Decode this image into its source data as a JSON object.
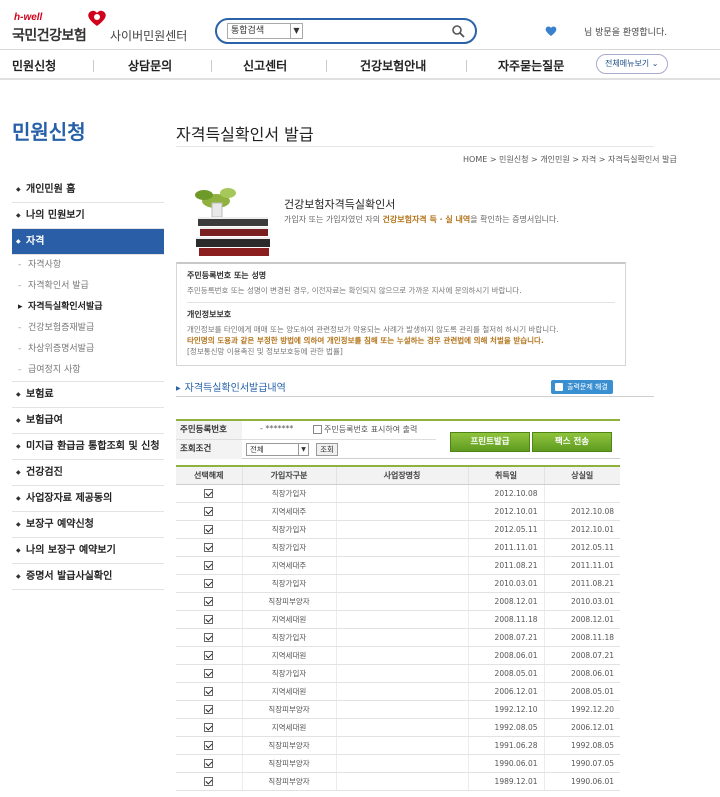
{
  "brand": {
    "sub": "h-well",
    "name": "국민건강보험",
    "center": "사이버민원센터"
  },
  "search": {
    "select_value": "통합검색",
    "query": ""
  },
  "welcome": "님 방문을 환영합니다.",
  "gnb": {
    "items": [
      "민원신청",
      "상담문의",
      "신고센터",
      "건강보험안내",
      "자주묻는질문"
    ],
    "all_menu": "전체메뉴보기"
  },
  "sidebar": {
    "title": "민원신청",
    "items": [
      {
        "label": "개인민원 홈"
      },
      {
        "label": "나의 민원보기"
      },
      {
        "label": "자격"
      },
      {
        "label": "보험료"
      },
      {
        "label": "보험급여"
      },
      {
        "label": "미지급 환급금 통합조회 및 신청"
      },
      {
        "label": "건강검진"
      },
      {
        "label": "사업장자료 제공동의"
      },
      {
        "label": "보장구 예약신청"
      },
      {
        "label": "나의 보장구 예약보기"
      },
      {
        "label": "증명서 발급사실확인"
      }
    ],
    "sub_items": [
      "자격사항",
      "자격확인서 발급",
      "자격득실확인서발급",
      "건강보험증재발급",
      "차상위증명서발급",
      "급여정지 사항"
    ]
  },
  "page": {
    "title": "자격득실확인서 발급",
    "breadcrumb": "HOME > 민원신청 > 개인민원 > 자격 > 자격득실확인서 발급"
  },
  "intro": {
    "title": "건강보험자격득실확인서",
    "desc_prefix": "가입자 또는 가입자였던 자의 ",
    "desc_highlight": "건강보험자격 득 · 실 내역",
    "desc_suffix": "을 확인하는 증명서입니다."
  },
  "notice": {
    "h1": "주민등록번호 또는 성명",
    "p1": "주민등록번호 또는 성명이 변경된 경우, 이전자료는 확인되지 않으므로 가까운 지사에 문의하시기 바랍니다.",
    "h2": "개인정보보호",
    "p2": "개인정보를 타인에게 매매 또는 양도하여 관련정보가 악용되는 사례가 발생하지 않도록 관리를 철저히 하시기 바랍니다.",
    "p3": "타인명의 도용과 같은 부정한 방법에 의하여 개인정보를 침해 또는 누설하는 경우 관련법에 의해 처벌을 받습니다.",
    "p4": "[정보통신망 이용촉진 및 정보보호등에 관한 법률]"
  },
  "section": {
    "title": "자격득실확인서발급내역",
    "print_doc_button": "출력문제 해결"
  },
  "form": {
    "ssn_label": "주민등록번호",
    "ssn_value": "- *******",
    "ssn_show_label": "주민등록번호 표시하여 출력",
    "cond_label": "조회조건",
    "cond_value": "전체",
    "cond_button": "조회",
    "print_button": "프린트발급",
    "fax_button": "팩스 전송"
  },
  "table": {
    "headers": [
      "선택해제",
      "가입자구분",
      "사업장명칭",
      "취득일",
      "상실일"
    ],
    "rows": [
      {
        "type": "직장가입자",
        "name": "",
        "acquired": "2012.10.08",
        "lost": ""
      },
      {
        "type": "지역세대주",
        "name": "",
        "acquired": "2012.10.01",
        "lost": "2012.10.08"
      },
      {
        "type": "직장가입자",
        "name": "",
        "acquired": "2012.05.11",
        "lost": "2012.10.01"
      },
      {
        "type": "직장가입자",
        "name": "",
        "acquired": "2011.11.01",
        "lost": "2012.05.11"
      },
      {
        "type": "지역세대주",
        "name": "",
        "acquired": "2011.08.21",
        "lost": "2011.11.01"
      },
      {
        "type": "직장가입자",
        "name": "",
        "acquired": "2010.03.01",
        "lost": "2011.08.21"
      },
      {
        "type": "직장피부양자",
        "name": "",
        "acquired": "2008.12.01",
        "lost": "2010.03.01"
      },
      {
        "type": "지역세대원",
        "name": "",
        "acquired": "2008.11.18",
        "lost": "2008.12.01"
      },
      {
        "type": "직장가입자",
        "name": "",
        "acquired": "2008.07.21",
        "lost": "2008.11.18"
      },
      {
        "type": "지역세대원",
        "name": "",
        "acquired": "2008.06.01",
        "lost": "2008.07.21"
      },
      {
        "type": "직장가입자",
        "name": "",
        "acquired": "2008.05.01",
        "lost": "2008.06.01"
      },
      {
        "type": "지역세대원",
        "name": "",
        "acquired": "2006.12.01",
        "lost": "2008.05.01"
      },
      {
        "type": "직장피부양자",
        "name": "",
        "acquired": "1992.12.10",
        "lost": "1992.12.20"
      },
      {
        "type": "지역세대원",
        "name": "",
        "acquired": "1992.08.05",
        "lost": "2006.12.01"
      },
      {
        "type": "직장피부양자",
        "name": "",
        "acquired": "1991.06.28",
        "lost": "1992.08.05"
      },
      {
        "type": "직장피부양자",
        "name": "",
        "acquired": "1990.06.01",
        "lost": "1990.07.05"
      },
      {
        "type": "직장피부양자",
        "name": "",
        "acquired": "1989.12.01",
        "lost": "1990.06.01"
      }
    ]
  },
  "colors": {
    "brand_blue": "#2660a8",
    "brand_red": "#d0021b",
    "table_green": "#8fb23e",
    "highlight_gold": "#b3741b"
  }
}
